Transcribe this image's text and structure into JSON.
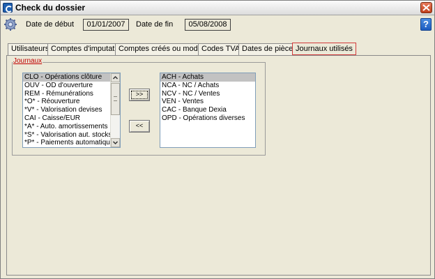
{
  "window": {
    "title": "Check du dossier"
  },
  "header": {
    "start_label": "Date de début",
    "start_value": "01/01/2007",
    "end_label": "Date de fin",
    "end_value": "05/08/2008",
    "help_label": "?"
  },
  "tabs": [
    {
      "label": "Utilisateurs",
      "active": false
    },
    {
      "label": "Comptes d'imputation",
      "active": false
    },
    {
      "label": "Comptes créés ou modifiés",
      "active": false
    },
    {
      "label": "Codes TVA",
      "active": false
    },
    {
      "label": "Dates de pièces",
      "active": false
    },
    {
      "label": "Journaux utilisés",
      "active": true
    }
  ],
  "group": {
    "legend": "Journaux"
  },
  "available_list": {
    "items": [
      "CLO - Opérations clôture",
      "OUV - OD d'ouverture",
      "REM - Rémunérations",
      "*O* - Réouverture",
      "*V* - Valorisation devises",
      "CAI - Caisse/EUR",
      "*A* - Auto. amortissements",
      "*S* - Valorisation aut. stocks",
      "*P* - Paiements automatiques"
    ],
    "selected_index": 0
  },
  "selected_list": {
    "items": [
      "ACH - Achats",
      "NCA - NC / Achats",
      "NCV - NC / Ventes",
      "VEN - Ventes",
      "CAC - Banque Dexia",
      "OPD - Opérations diverses"
    ],
    "selected_index": 0
  },
  "buttons": {
    "add_label": ">>",
    "remove_label": "<<"
  },
  "colors": {
    "active_tab_border": "#d23a3a",
    "legend_text": "#c00000",
    "window_bg": "#ece9d8",
    "selection_bg": "#c2c2c2"
  }
}
